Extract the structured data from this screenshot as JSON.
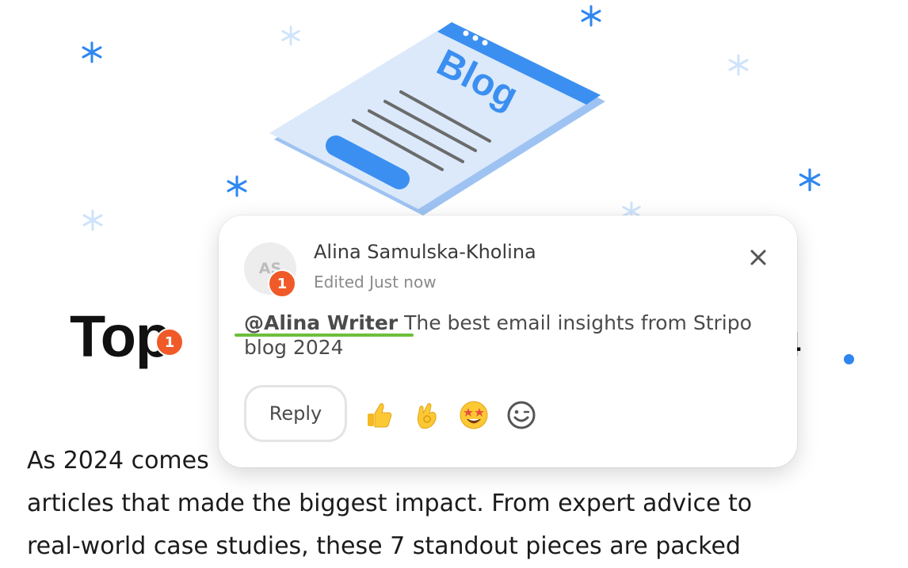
{
  "colors": {
    "accent": "#2e86f0",
    "badge": "#f05a28",
    "mention_underline": "#6cbf3a",
    "card_bg": "#ffffff"
  },
  "hero": {
    "illustration_label": "Blog"
  },
  "article": {
    "headline_visible": "Top",
    "headline_tail_visible": "4",
    "body_lines": [
      "As 2024 comes",
      "articles that made the biggest impact. From expert advice to",
      "real-world case studies, these 7 standout pieces are packed"
    ]
  },
  "comment_popup": {
    "avatar_initials": "AS",
    "badge_count": "1",
    "author_name": "Alina Samulska-Kholina",
    "meta": "Edited Just now",
    "mention": "@Alina Writer",
    "text": " The best email insights from Stripo blog 2024",
    "reply_label": "Reply",
    "reactions": [
      "thumbs-up",
      "ok-hand",
      "star-struck",
      "add-emoji"
    ]
  },
  "inline_marker": {
    "badge_count": "1"
  },
  "icons": {
    "close": "close-icon",
    "add_reaction": "smile-icon"
  }
}
